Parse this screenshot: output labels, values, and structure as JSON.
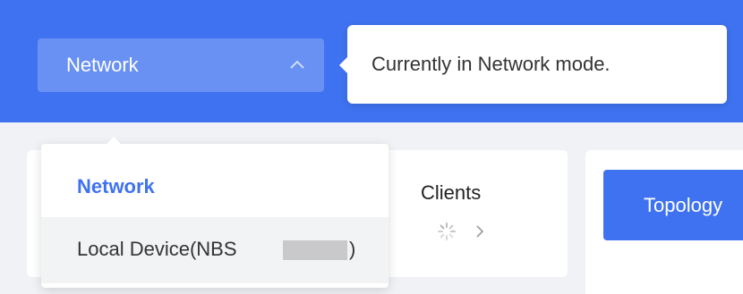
{
  "header": {
    "mode_selector": {
      "label": "Network",
      "icon": "chevron-up-icon"
    },
    "tooltip": {
      "text": "Currently in Network mode."
    }
  },
  "dropdown": {
    "items": [
      {
        "label": "Network",
        "selected": true
      },
      {
        "label": "Local Device(NBS",
        "suffix": ")",
        "selected": false
      }
    ]
  },
  "cards": {
    "clients": {
      "title": "Clients",
      "icons": [
        "spinner-icon",
        "chevron-right-icon"
      ]
    }
  },
  "topology_button": {
    "label": "Topology"
  },
  "colors": {
    "accent": "#3f72f0",
    "page_background": "#f0f2f5",
    "hover_item": "#f2f3f5",
    "text_primary": "#333333"
  }
}
